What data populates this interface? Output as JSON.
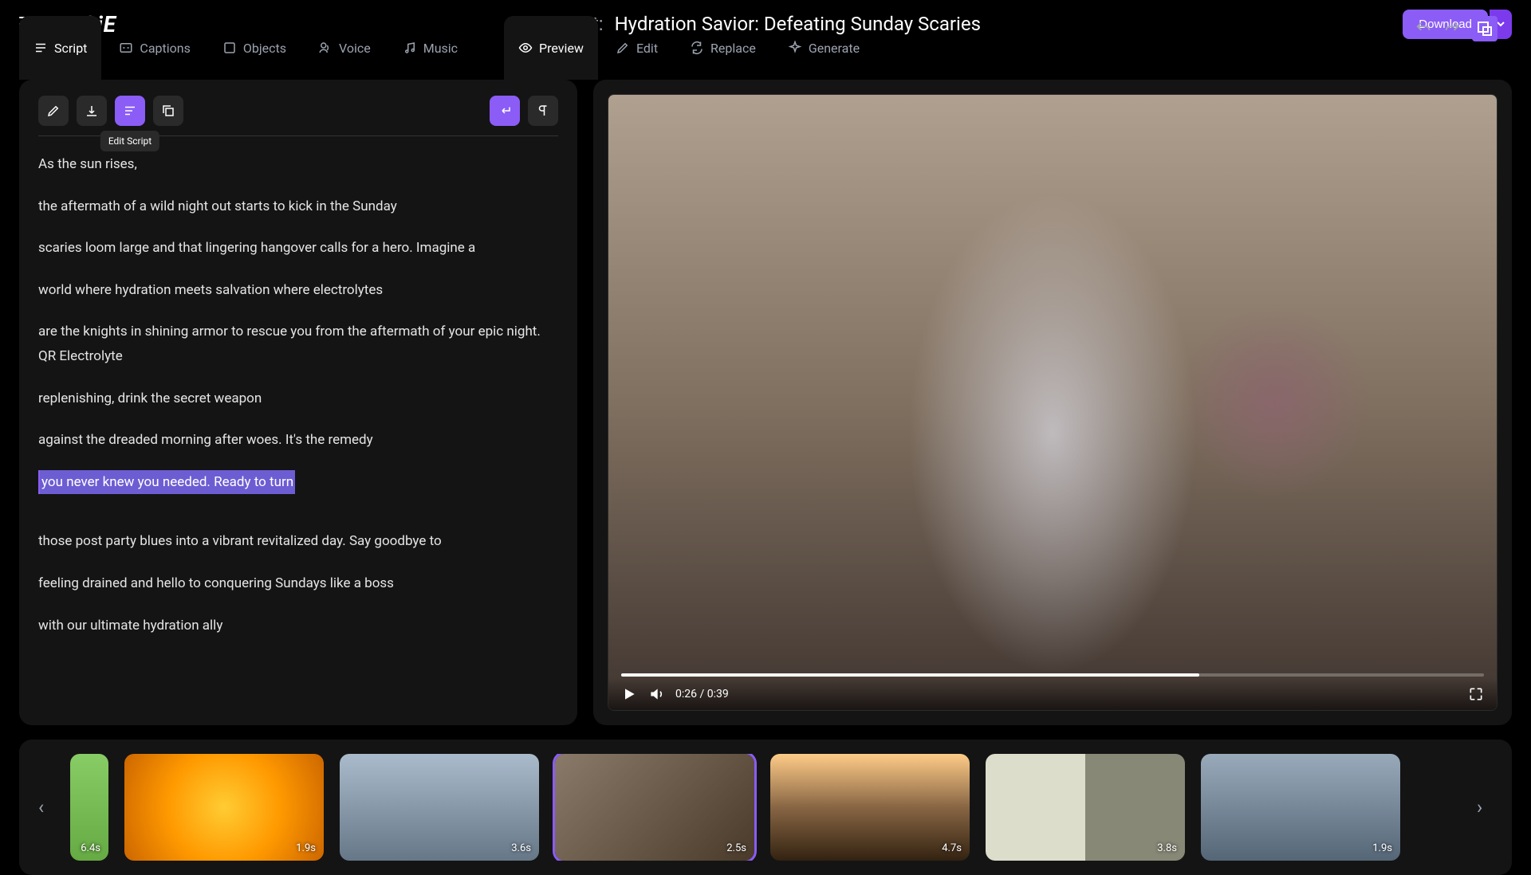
{
  "header": {
    "project_label": "Project:",
    "project_name": "Hydration Savior: Defeating Sunday Scaries",
    "download_label": "Download"
  },
  "left_tabs": [
    {
      "id": "script",
      "label": "Script",
      "active": true
    },
    {
      "id": "captions",
      "label": "Captions",
      "active": false
    },
    {
      "id": "objects",
      "label": "Objects",
      "active": false
    },
    {
      "id": "voice",
      "label": "Voice",
      "active": false
    },
    {
      "id": "music",
      "label": "Music",
      "active": false
    }
  ],
  "right_tabs": [
    {
      "id": "preview",
      "label": "Preview",
      "active": true
    },
    {
      "id": "edit",
      "label": "Edit",
      "active": false
    },
    {
      "id": "replace",
      "label": "Replace",
      "active": false
    },
    {
      "id": "generate",
      "label": "Generate",
      "active": false
    }
  ],
  "toolbar": {
    "tooltip_edit_script": "Edit Script"
  },
  "script_lines": [
    {
      "text": "As the sun rises,",
      "highlighted": false
    },
    {
      "text": "the aftermath of a wild night out starts to kick in the Sunday",
      "highlighted": false
    },
    {
      "text": "scaries loom large and that lingering hangover calls for a hero. Imagine a",
      "highlighted": false
    },
    {
      "text": "world where hydration meets salvation where electrolytes",
      "highlighted": false
    },
    {
      "text": "are the knights in shining armor to rescue you from the aftermath of your epic night. QR Electrolyte",
      "highlighted": false
    },
    {
      "text": "replenishing, drink the secret weapon",
      "highlighted": false
    },
    {
      "text": "against the dreaded morning after woes. It's the remedy",
      "highlighted": false
    },
    {
      "text": "you never knew you needed. Ready to turn",
      "highlighted": true
    },
    {
      "text": "those post party blues into a vibrant revitalized day. Say goodbye to",
      "highlighted": false
    },
    {
      "text": "feeling drained and hello to conquering Sundays like a boss",
      "highlighted": false
    },
    {
      "text": "with our ultimate hydration ally",
      "highlighted": false
    }
  ],
  "video": {
    "current_time": "0:26",
    "total_time": "0:39",
    "time_display": "0:26 / 0:39",
    "progress_percent": 67
  },
  "timeline_clips": [
    {
      "duration": "6.4s",
      "selected": false
    },
    {
      "duration": "1.9s",
      "selected": false
    },
    {
      "duration": "3.6s",
      "selected": false
    },
    {
      "duration": "2.5s",
      "selected": true
    },
    {
      "duration": "4.7s",
      "selected": false
    },
    {
      "duration": "3.8s",
      "selected": false
    },
    {
      "duration": "1.9s",
      "selected": false
    }
  ]
}
